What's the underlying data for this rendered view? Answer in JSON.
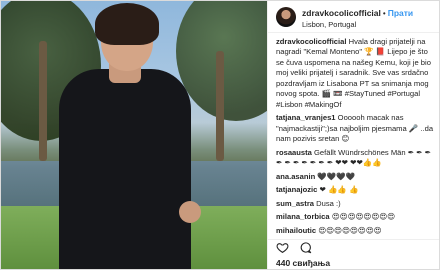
{
  "post": {
    "username": "zdravkocolicofficial",
    "follow_label": "Прати",
    "location": "Lisbon, Portugal",
    "caption": "Hvala dragi prijatelji na nagradi \"Kemal Monteno\" 🏆 📕 Lijepo je što se čuva uspomena na našeg Kemu, koji je bio moj veliki prijatelj i saradnik. Sve vas srdačno pozdravljam iz Lisabona PT sa snimanja mog novog spota. 🎬 📼 #StayTuned #Portugal #Lisbon #MakingOf",
    "likes": "440 свиђања"
  },
  "comments": [
    {
      "user": "tatjana_vranjes1",
      "text": "Oooooh macak nas \"najmackastiji\";)sa najboljim pjesmama 🎤 ..da nam pozivis sretan 😊"
    },
    {
      "user": "rosaausta",
      "text": "Gefällt Wündrschönes Män ✒ ✒ ✒ ✒ ✒ ✒ ✒ ✒ ✒ ✒ ❤❤ ❤❤👍👍"
    },
    {
      "user": "ana.asanin",
      "text": "🖤🖤🖤🖤"
    },
    {
      "user": "tatjanajozic",
      "text": "❤ 👍👍 👍"
    },
    {
      "user": "sum_astra",
      "text": "Dusa :)"
    },
    {
      "user": "milana_torbica",
      "text": "😍😍😍😍😍😍😍😍"
    },
    {
      "user": "mihailoutic",
      "text": "😍😍😍😍😍😍😍😍"
    }
  ],
  "icons": {
    "avatar": "profile-avatar",
    "like": "heart-icon",
    "comment": "comment-icon",
    "follow_dot": "•"
  },
  "colors": {
    "link_blue": "#3897f0",
    "text": "#262626",
    "border": "#dbdbdb"
  }
}
